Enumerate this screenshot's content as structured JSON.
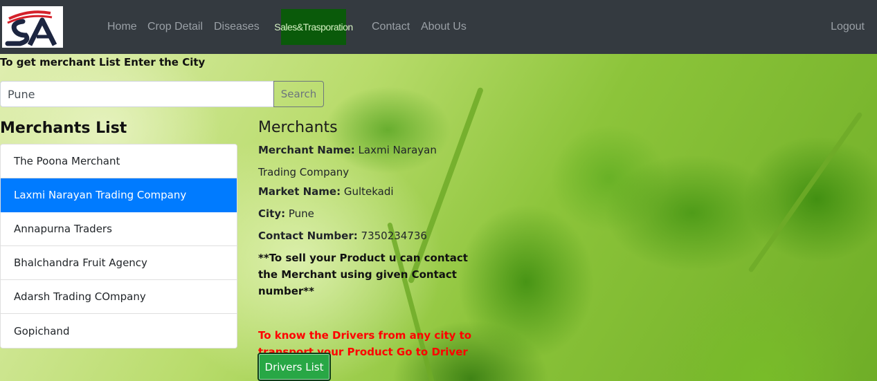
{
  "nav": {
    "home": "Home",
    "crop_detail": "Crop Detail",
    "diseases": "Diseases",
    "sales": "Sales&Trasporation",
    "contact": "Contact",
    "about": "About Us",
    "logout": "Logout"
  },
  "search": {
    "prompt": "To get merchant List Enter the City",
    "value": "Pune",
    "button": "Search"
  },
  "merchants": {
    "title": "Merchants List",
    "items": [
      "The Poona Merchant",
      "Laxmi Narayan Trading Company",
      "Annapurna Traders",
      "Bhalchandra Fruit Agency",
      "Adarsh Trading COmpany",
      "Gopichand"
    ],
    "active_index": 1
  },
  "detail": {
    "title": "Merchants",
    "merchant_name_label": "Merchant Name:",
    "merchant_name": "Laxmi Narayan Trading Company",
    "market_name_label": "Market Name:",
    "market_name": "Gultekadi",
    "city_label": "City:",
    "city": "Pune",
    "contact_label": "Contact Number:",
    "contact": "7350234736",
    "note": "**To sell your Product u can contact the Merchant using given Contact number**",
    "driver_note": "To know the Drivers from any city to transport your Product Go to Driver List",
    "drivers_button": "Drivers List"
  },
  "colors": {
    "navbar": "#343a40",
    "sales_button": "#0a5a0a",
    "active_item": "#007bff",
    "drivers_button": "#28a745",
    "driver_note": "#ff0000"
  }
}
